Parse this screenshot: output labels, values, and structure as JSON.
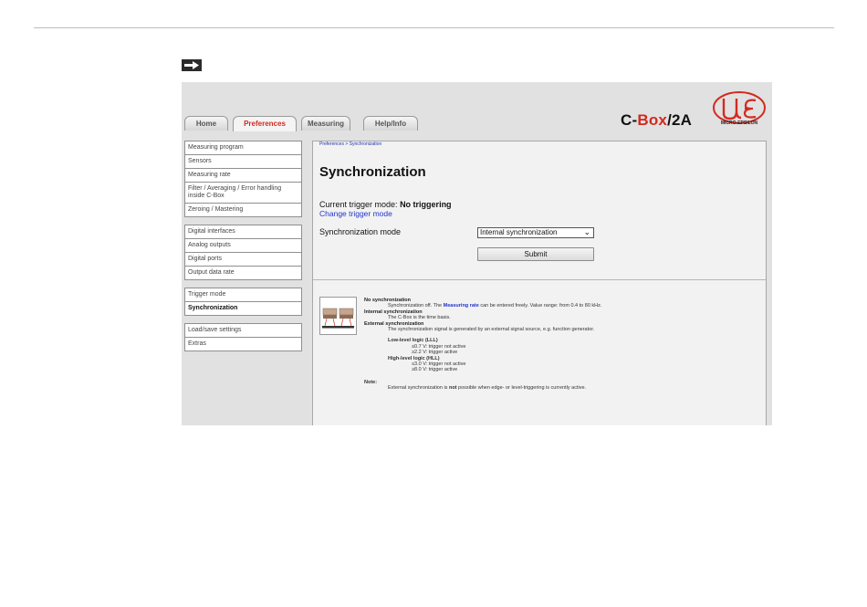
{
  "tabs": [
    "Home",
    "Preferences",
    "Measuring",
    "Help/Info"
  ],
  "brand": {
    "prefix": "C-",
    "highlight": "Box",
    "suffix": "/2A",
    "logo_text": "MICRO-EPSILON",
    "accent": "#d22a1f"
  },
  "sidebar": {
    "group1": [
      "Measuring program",
      "Sensors",
      "Measuring rate",
      "Filter / Averaging / Error handling inside C-Box",
      "Zeroing / Mastering"
    ],
    "group2": [
      "Digital interfaces",
      "Analog outputs",
      "Digital ports",
      "Output data rate"
    ],
    "group3": [
      "Trigger mode",
      "Synchronization"
    ],
    "group4": [
      "Load/save settings",
      "Extras"
    ]
  },
  "content": {
    "breadcrumb": "Preferences > Synchronization",
    "title": "Synchronization",
    "trigger_label": "Current trigger mode:",
    "trigger_value": "No triggering",
    "change_link": "Change trigger mode",
    "sync_label": "Synchronization mode",
    "sync_selected": "Internal synchronization",
    "submit_label": "Submit"
  },
  "help": {
    "no_sync_title": "No synchronization",
    "no_sync_pre": "Synchronization off. The",
    "no_sync_link": "Measuring rate",
    "no_sync_post": "can be entered freely. Value range: from 0.4 to 80 kHz.",
    "internal_title": "Internal synchronization",
    "internal_text": "The C-Box is the time basis.",
    "external_title": "External synchronization",
    "external_text": "The synchronization signal is generated by an external signal source, e.g. function generator.",
    "lll_title": "Low-level logic (LLL)",
    "lll_1": "≤0.7 V: trigger not active",
    "lll_2": "≥2.2 V: trigger active",
    "hll_title": "High-level logic (HLL)",
    "hll_1": "≤3.0 V: trigger not active",
    "hll_2": "≥8.0 V: trigger active",
    "note_title": "Note:",
    "note_pre": "External synchronization is",
    "note_bold": "not",
    "note_post": "possible when edge- or level-triggering is currently active."
  }
}
